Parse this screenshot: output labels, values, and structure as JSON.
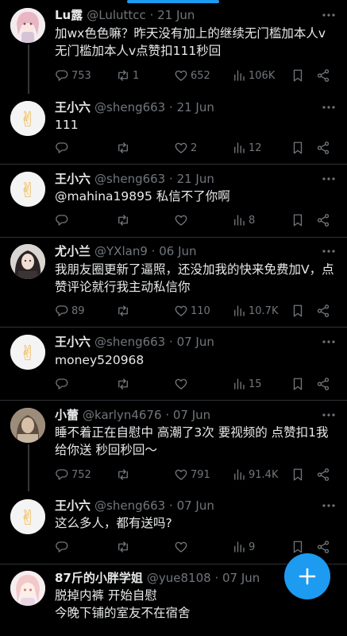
{
  "tweets": [
    {
      "id": "t1",
      "name": "Lu露",
      "handle": "@Luluttcc",
      "sep": "·",
      "date": "21 Jun",
      "text": "加wx色色嘛？昨天没有加上的继续无门槛加本人v 无门槛加本人v点赞扣111秒回",
      "avatar": "anime-girl-avatar",
      "replies": "753",
      "retweets": "1",
      "likes": "652",
      "views": "106K"
    },
    {
      "id": "t2",
      "name": "王小六",
      "handle": "@sheng663",
      "sep": "·",
      "date": "21 Jun",
      "text": "111",
      "avatar": "victory-hand-emoji-avatar",
      "replies": "",
      "retweets": "",
      "likes": "2",
      "views": "12"
    },
    {
      "id": "t3",
      "name": "王小六",
      "handle": "@sheng663",
      "sep": "·",
      "date": "21 Jun",
      "text": "@mahina19895 私信不了你啊",
      "avatar": "victory-hand-emoji-avatar",
      "replies": "",
      "retweets": "",
      "likes": "",
      "views": "8"
    },
    {
      "id": "t4",
      "name": "尤小兰",
      "handle": "@YXlan9",
      "sep": "·",
      "date": "06 Jun",
      "text": "我朋友圈更新了逼照，还没加我的快来免费加V，点赞评论就行我主动私信你",
      "avatar": "dark-hair-girl-avatar",
      "replies": "89",
      "retweets": "",
      "likes": "110",
      "views": "10.7K"
    },
    {
      "id": "t5",
      "name": "王小六",
      "handle": "@sheng663",
      "sep": "·",
      "date": "07 Jun",
      "text": "money520968",
      "avatar": "victory-hand-emoji-avatar",
      "replies": "",
      "retweets": "",
      "likes": "",
      "views": "15"
    },
    {
      "id": "t6",
      "name": "小蕾",
      "handle": "@karlyn4676",
      "sep": "·",
      "date": "07 Jun",
      "text": "睡不着正在自慰中 高潮了3次 要视频的 点赞扣1我给你送 秒回秒回～",
      "avatar": "blurred-girl-avatar",
      "replies": "752",
      "retweets": "",
      "likes": "791",
      "views": "91.4K"
    },
    {
      "id": "t7",
      "name": "王小六",
      "handle": "@sheng663",
      "sep": "·",
      "date": "07 Jun",
      "text": "这么多人，都有送吗?",
      "avatar": "victory-hand-emoji-avatar",
      "replies": "",
      "retweets": "",
      "likes": "",
      "views": "9"
    },
    {
      "id": "t8",
      "name": "87斤的小胖学姐",
      "handle": "@yue8108",
      "sep": "·",
      "date": "07 Jun",
      "text": "脱掉内裤 开始自慰\n今晚下铺的室友不在宿舍",
      "avatar": "anime-girl-pink-avatar"
    }
  ],
  "icons": {
    "reply": "reply-icon",
    "retweet": "retweet-icon",
    "like": "heart-icon",
    "views": "views-bar-chart-icon",
    "bookmark": "bookmark-icon",
    "share": "share-icon",
    "more": "more-dots-icon",
    "compose": "plus-icon"
  },
  "colors": {
    "background": "#000000",
    "text": "#e7e9ea",
    "secondary": "#71767b",
    "divider": "#2f3336",
    "accent": "#1d9bf0"
  }
}
